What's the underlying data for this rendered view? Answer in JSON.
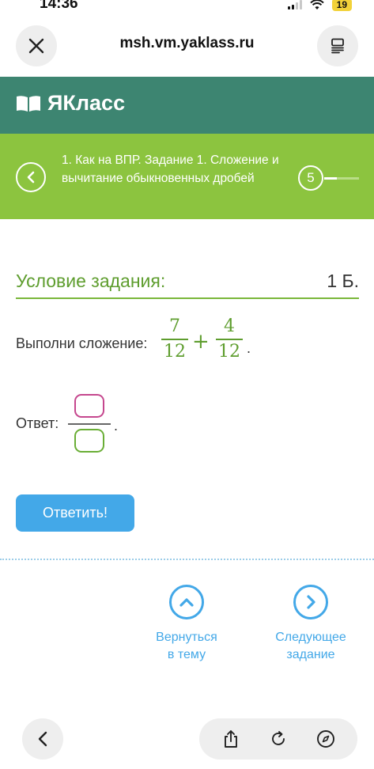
{
  "status": {
    "time": "14:36",
    "battery": "19"
  },
  "browser": {
    "url": "msh.vm.yaklass.ru"
  },
  "brand": {
    "name": "ЯКласс"
  },
  "topic": {
    "title": "1. Как на ВПР. Задание 1. Сложение и вычитание обыкновенных дробей",
    "step": "5"
  },
  "task": {
    "header": "Условие задания:",
    "points": "1 Б.",
    "instruction": "Выполни сложение:",
    "fraction1": {
      "numerator": "7",
      "denominator": "12"
    },
    "operator": "+",
    "fraction2": {
      "numerator": "4",
      "denominator": "12"
    },
    "end_dot": ".",
    "answer_label": "Ответ:",
    "answer_dot": ".",
    "answer_numerator_value": "",
    "answer_denominator_value": "",
    "submit_label": "Ответить!"
  },
  "navigation": {
    "back_label_line1": "Вернуться",
    "back_label_line2": "в тему",
    "next_label_line1": "Следующее",
    "next_label_line2": "задание"
  },
  "colors": {
    "brand_green": "#3d8571",
    "topic_green": "#8cc43f",
    "accent_blue": "#43a8e8",
    "math_green": "#5e9d2e",
    "numerator_box": "#c5478e",
    "denominator_box": "#6aae36"
  }
}
